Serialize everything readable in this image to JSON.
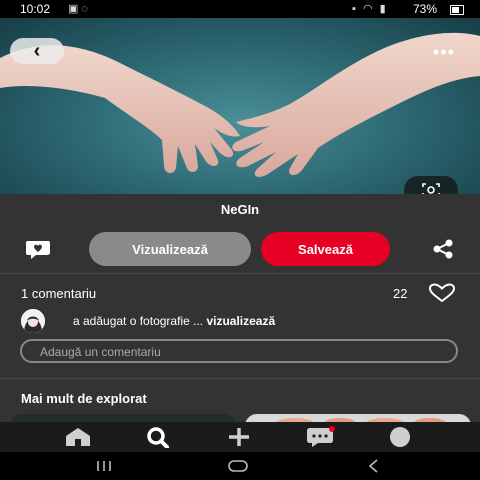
{
  "status_bar": {
    "time": "10:02",
    "battery_percent": "73%",
    "left_icons": [
      "image-icon",
      "whatsapp-icon"
    ],
    "right_icons": [
      "lock-icon",
      "wifi-icon",
      "signal-icon",
      "battery-icon"
    ]
  },
  "pin": {
    "title": "NeGIn",
    "view_label": "Vizualizează",
    "save_label": "Salvează",
    "comments_label": "1 comentariu",
    "likes": "22",
    "activity_text": "a adăugat o fotografie ...",
    "activity_link": "vizualizează",
    "comment_placeholder": "Adaugă un comentariu",
    "explore_title": "Mai mult de explorat"
  },
  "colors": {
    "save_button": "#e60023",
    "view_button": "#8a8a8a",
    "panel_background": "#333333",
    "hero_teal": "#2e6b76"
  },
  "nav": {
    "items": [
      "home-icon",
      "search-icon",
      "create-icon",
      "messages-icon",
      "profile-icon"
    ],
    "active": "search-icon"
  },
  "system_nav": [
    "recents-icon",
    "home-button-icon",
    "back-icon"
  ]
}
